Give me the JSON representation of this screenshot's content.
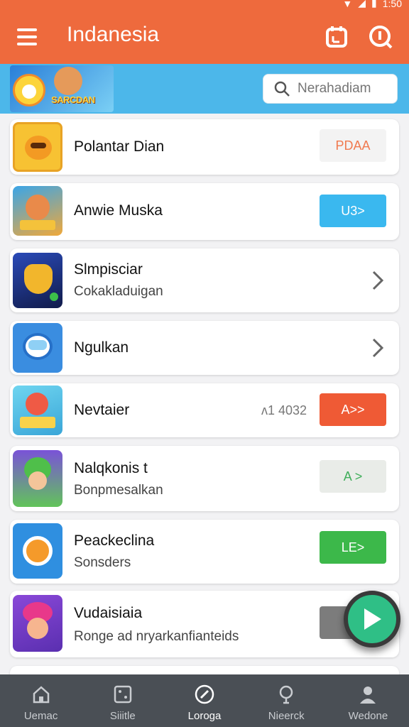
{
  "status": {
    "time": "1:50",
    "colors": {
      "bar": "#ee6a3d"
    }
  },
  "app_bar": {
    "title": "Indanesia",
    "icons": [
      "menu-icon",
      "calendar-icon",
      "info-icon"
    ]
  },
  "banner": {
    "logo_text": "SARCDAN",
    "search_placeholder": "Nerahadiam"
  },
  "items": [
    {
      "title": "Polantar Dian",
      "subtitle": "",
      "action": {
        "kind": "button",
        "label": "PDAA",
        "color": "#f3f3f3",
        "text_color": "#f07a4f"
      }
    },
    {
      "title": "Anwie Muska",
      "subtitle": "",
      "action": {
        "kind": "button",
        "label": "U3>",
        "color": "#3ab8ef",
        "text_color": "#ffffff"
      }
    },
    {
      "title": "Slmpisciar",
      "subtitle": "Cokakladuigan",
      "action": {
        "kind": "chevron"
      }
    },
    {
      "title": "Ngulkan",
      "subtitle": "",
      "action": {
        "kind": "chevron"
      }
    },
    {
      "title": "Nevtaier",
      "subtitle": "",
      "meta": "ᴧ1 4032",
      "action": {
        "kind": "button",
        "label": "A>>",
        "color": "#ef5a35",
        "text_color": "#ffffff"
      }
    },
    {
      "title": "Nalqkonis t",
      "subtitle": "Bonpmesalkan",
      "action": {
        "kind": "button",
        "label": "A >",
        "color": "#e9ece8",
        "text_color": "#3fae5a"
      }
    },
    {
      "title": "Peackeclina",
      "subtitle": "Sonsders",
      "action": {
        "kind": "button",
        "label": "LE>",
        "color": "#3cb84a",
        "text_color": "#ffffff"
      }
    },
    {
      "title": "Vudaisiaia",
      "subtitle": "Ronge ad nryarkanfianteids",
      "action": {
        "kind": "button",
        "label": "L",
        "color": "#7c7c7c",
        "text_color": "#ffffff"
      }
    }
  ],
  "bottom_nav": [
    {
      "label": "Uemac",
      "icon": "home-icon"
    },
    {
      "label": "Siiitle",
      "icon": "grid-icon"
    },
    {
      "label": "Loroga",
      "icon": "compass-icon",
      "active": true
    },
    {
      "label": "Nieerck",
      "icon": "bulb-icon"
    },
    {
      "label": "Wedone",
      "icon": "profile-icon"
    }
  ]
}
